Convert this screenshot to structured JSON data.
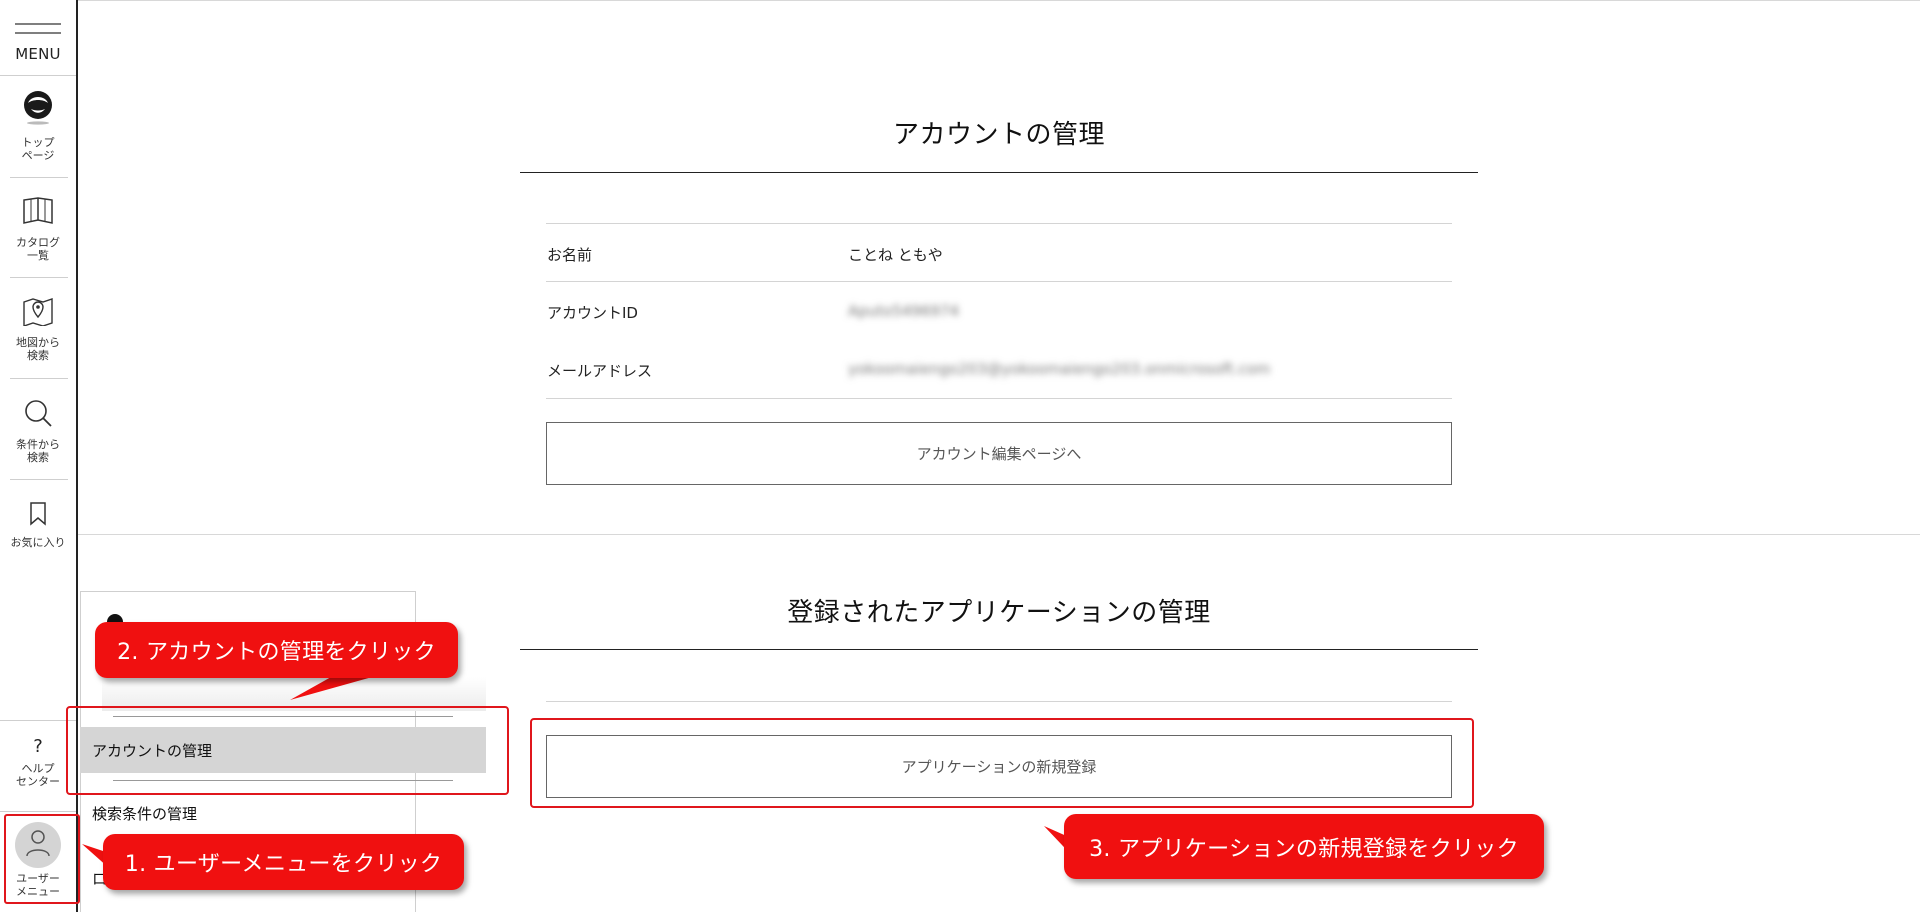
{
  "sidebar": {
    "menu_label": "MENU",
    "items": [
      {
        "label": "トップ\nページ",
        "icon": "logo-icon"
      },
      {
        "label": "カタログ\n一覧",
        "icon": "book-icon"
      },
      {
        "label": "地図から\n検索",
        "icon": "map-pin-icon"
      },
      {
        "label": "条件から\n検索",
        "icon": "search-icon"
      },
      {
        "label": "お気に入り",
        "icon": "bookmark-icon"
      },
      {
        "label": "ヘルプ\nセンター",
        "icon": "help-icon"
      },
      {
        "label": "ユーザー\nメニュー",
        "icon": "user-icon"
      }
    ]
  },
  "account": {
    "title": "アカウントの管理",
    "rows": [
      {
        "label": "お名前",
        "value": "ことね ともや"
      },
      {
        "label": "アカウントID",
        "value": "Aputo5496974"
      },
      {
        "label": "メールアドレス",
        "value": "yokoomaiengo203@yokoomaiengo203.onmicrosoft.com"
      }
    ],
    "edit_button": "アカウント編集ページへ"
  },
  "applications": {
    "title": "登録されたアプリケーションの管理",
    "new_button": "アプリケーションの新規登録"
  },
  "user_dropdown": {
    "items": [
      {
        "label": "アカウントの管理"
      },
      {
        "label": "検索条件の管理"
      }
    ],
    "clipped_item": "ロ"
  },
  "annotations": {
    "step1": "1. ユーザーメニューをクリック",
    "step2": "2. アカウントの管理をクリック",
    "step3": "3. アプリケーションの新規登録をクリック"
  },
  "colors": {
    "annotation_red": "#f01010",
    "highlight_red": "#e0161c",
    "active_item_bg": "#d5d5d5"
  }
}
